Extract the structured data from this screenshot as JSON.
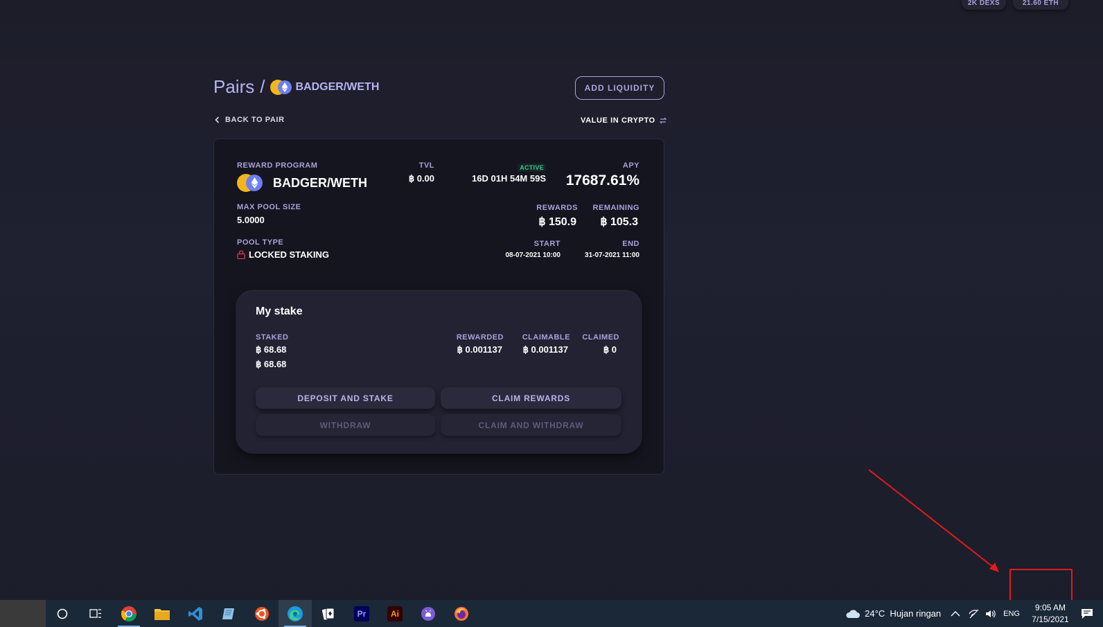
{
  "top_pills": [
    "2K DEXS",
    "21.60 ETH"
  ],
  "breadcrumb": {
    "root": "Pairs",
    "sep": "/",
    "pair": "BADGER/WETH"
  },
  "add_liquidity_label": "ADD LIQUIDITY",
  "back_label": "BACK TO PAIR",
  "value_toggle_label": "VALUE IN CRYPTO",
  "program": {
    "label": "REWARD PROGRAM",
    "name": "BADGER/WETH",
    "tvl_label": "TVL",
    "tvl_value": "฿ 0.00",
    "status": "ACTIVE",
    "countdown": "16D 01H 54M 59S",
    "apy_label": "APY",
    "apy_value": "17687.61%",
    "max_pool_label": "MAX POOL SIZE",
    "max_pool_value": "5.0000",
    "rewards_label": "REWARDS",
    "rewards_value": "฿ 150.9",
    "remaining_label": "REMAINING",
    "remaining_value": "฿ 105.3",
    "pool_type_label": "POOL TYPE",
    "pool_type_value": "LOCKED STAKING",
    "start_label": "START",
    "start_value": "08-07-2021 10:00",
    "end_label": "END",
    "end_value": "31-07-2021 11:00"
  },
  "my_stake": {
    "title": "My stake",
    "staked_label": "STAKED",
    "staked_values": [
      "฿ 68.68",
      "฿ 68.68"
    ],
    "rewarded_label": "REWARDED",
    "rewarded_value": "฿ 0.001137",
    "claimable_label": "CLAIMABLE",
    "claimable_value": "฿ 0.001137",
    "claimed_label": "CLAIMED",
    "claimed_value": "฿ 0",
    "buttons": {
      "deposit": "DEPOSIT AND STAKE",
      "claim": "CLAIM REWARDS",
      "withdraw": "WITHDRAW",
      "claim_withdraw": "CLAIM AND WITHDRAW"
    }
  },
  "taskbar": {
    "apps": [
      "search-icon",
      "task-view-icon",
      "chrome-icon",
      "file-explorer-icon",
      "vscode-icon",
      "notepad-icon",
      "ubuntu-icon",
      "edge-icon",
      "solitaire-icon",
      "premiere-icon",
      "illustrator-icon",
      "github-icon",
      "firefox-icon"
    ],
    "premiere_label": "Pr",
    "illustrator_label": "Ai",
    "weather": "24°C  Hujan ringan",
    "lang": "ENG",
    "time": "9:05 AM",
    "date": "7/15/2021"
  },
  "colors": {
    "accent": "#a9a4de",
    "active_green": "#34c98a",
    "annotation_red": "#e11b1b"
  }
}
